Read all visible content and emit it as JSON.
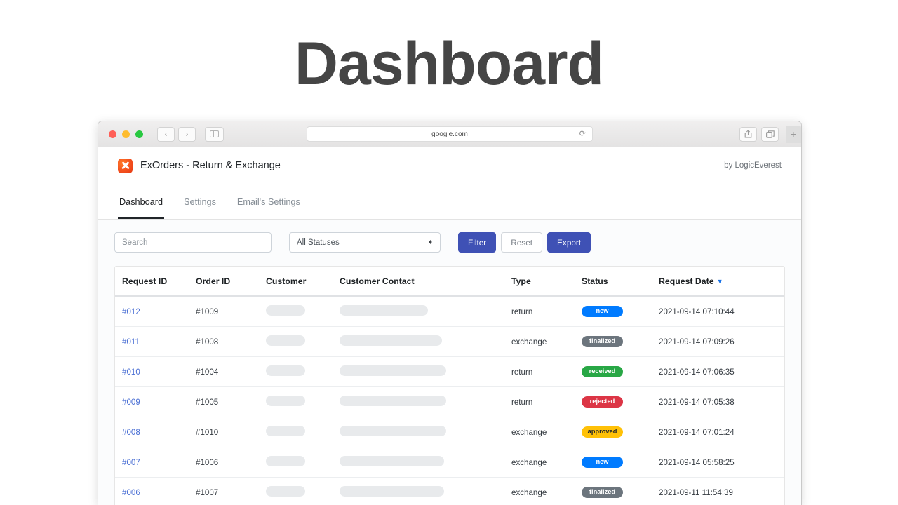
{
  "hero": {
    "title": "Dashboard"
  },
  "browser": {
    "traffic_lights": [
      "close-red",
      "minimize-yellow",
      "maximize-green"
    ],
    "back_label": "‹",
    "forward_label": "›",
    "sidebar_icon": "sidebar-icon",
    "url": "google.com",
    "reload_icon": "⟳",
    "share_icon": "share-icon",
    "tabs_icon": "tabs-overview-icon",
    "new_tab_label": "+"
  },
  "app": {
    "brand_title": "ExOrders - Return & Exchange",
    "brand_logo_icon": "exorders-logo-icon",
    "credit": "by LogicEverest",
    "tabs": [
      {
        "label": "Dashboard",
        "active": true
      },
      {
        "label": "Settings",
        "active": false
      },
      {
        "label": "Email's Settings",
        "active": false
      }
    ]
  },
  "toolbar": {
    "search_placeholder": "Search",
    "search_value": "",
    "status_select_value": "All Statuses",
    "select_up_icon": "▲",
    "select_down_icon": "▼",
    "filter_label": "Filter",
    "reset_label": "Reset",
    "export_label": "Export",
    "primary_color": "#3f51b5"
  },
  "table": {
    "columns": [
      "Request ID",
      "Order ID",
      "Customer",
      "Customer Contact",
      "Type",
      "Status",
      "Request Date"
    ],
    "sort_column": "Request Date",
    "sort_direction": "desc",
    "sort_caret": "▼",
    "sort_caret_color": "#1a73e8",
    "rows": [
      {
        "request_id": "#012",
        "order_id": "#1009",
        "customer_width": 56,
        "contact_width": 126,
        "type": "return",
        "status": "new",
        "status_class": "badge-new",
        "request_date": "2021-09-14 07:10:44"
      },
      {
        "request_id": "#011",
        "order_id": "#1008",
        "customer_width": 56,
        "contact_width": 146,
        "type": "exchange",
        "status": "finalized",
        "status_class": "badge-finalized",
        "request_date": "2021-09-14 07:09:26"
      },
      {
        "request_id": "#010",
        "order_id": "#1004",
        "customer_width": 56,
        "contact_width": 152,
        "type": "return",
        "status": "received",
        "status_class": "badge-received",
        "request_date": "2021-09-14 07:06:35"
      },
      {
        "request_id": "#009",
        "order_id": "#1005",
        "customer_width": 56,
        "contact_width": 152,
        "type": "return",
        "status": "rejected",
        "status_class": "badge-rejected",
        "request_date": "2021-09-14 07:05:38"
      },
      {
        "request_id": "#008",
        "order_id": "#1010",
        "customer_width": 56,
        "contact_width": 152,
        "type": "exchange",
        "status": "approved",
        "status_class": "badge-approved",
        "request_date": "2021-09-14 07:01:24"
      },
      {
        "request_id": "#007",
        "order_id": "#1006",
        "customer_width": 56,
        "contact_width": 149,
        "type": "exchange",
        "status": "new",
        "status_class": "badge-new",
        "request_date": "2021-09-14 05:58:25"
      },
      {
        "request_id": "#006",
        "order_id": "#1007",
        "customer_width": 56,
        "contact_width": 149,
        "type": "exchange",
        "status": "finalized",
        "status_class": "badge-finalized",
        "request_date": "2021-09-11 11:54:39"
      }
    ]
  },
  "colors": {
    "badge_new": "#007bff",
    "badge_finalized": "#6c757d",
    "badge_received": "#28a745",
    "badge_rejected": "#dc3545",
    "badge_approved": "#ffc107",
    "link": "#4a6fd4",
    "title": "#454545"
  }
}
